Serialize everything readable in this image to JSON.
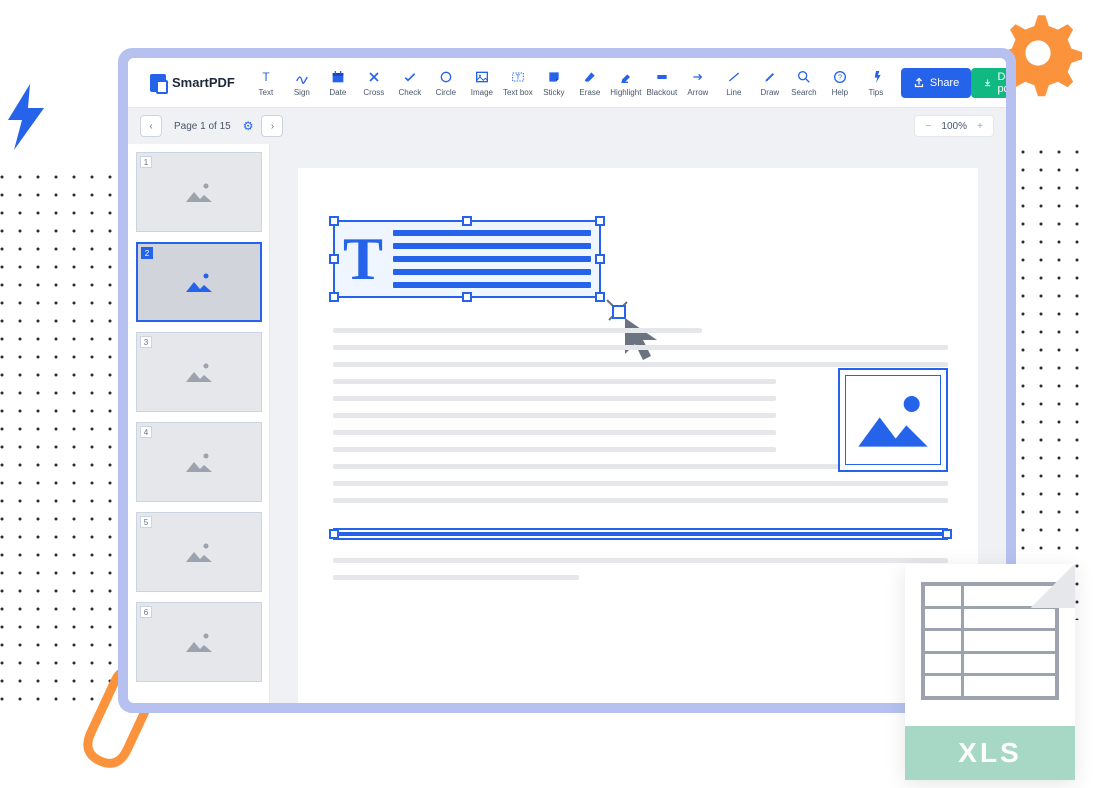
{
  "app": {
    "name": "SmartPDF"
  },
  "toolbar": {
    "tools": [
      {
        "id": "text",
        "label": "Text"
      },
      {
        "id": "sign",
        "label": "Sign"
      },
      {
        "id": "date",
        "label": "Date"
      },
      {
        "id": "cross",
        "label": "Cross"
      },
      {
        "id": "check",
        "label": "Check"
      },
      {
        "id": "circle",
        "label": "Circle"
      },
      {
        "id": "image",
        "label": "Image"
      },
      {
        "id": "textbox",
        "label": "Text box"
      },
      {
        "id": "sticky",
        "label": "Sticky"
      },
      {
        "id": "erase",
        "label": "Erase"
      },
      {
        "id": "highlight",
        "label": "Highlight"
      },
      {
        "id": "blackout",
        "label": "Blackout"
      },
      {
        "id": "arrow",
        "label": "Arrow"
      },
      {
        "id": "line",
        "label": "Line"
      },
      {
        "id": "draw",
        "label": "Draw"
      }
    ],
    "utils": [
      {
        "id": "search",
        "label": "Search"
      },
      {
        "id": "help",
        "label": "Help"
      },
      {
        "id": "tips",
        "label": "Tips"
      }
    ],
    "share": "Share",
    "download": "Download pdf"
  },
  "pager": {
    "text": "Page 1 of 15",
    "current": 1,
    "total": 15
  },
  "zoom": {
    "value": "100%"
  },
  "thumbnails": [
    {
      "num": "1",
      "active": false
    },
    {
      "num": "2",
      "active": true
    },
    {
      "num": "3",
      "active": false
    },
    {
      "num": "4",
      "active": false
    },
    {
      "num": "5",
      "active": false
    },
    {
      "num": "6",
      "active": false
    }
  ],
  "editor": {
    "text_glyph": "T"
  },
  "overlay": {
    "file_label": "XLS"
  }
}
